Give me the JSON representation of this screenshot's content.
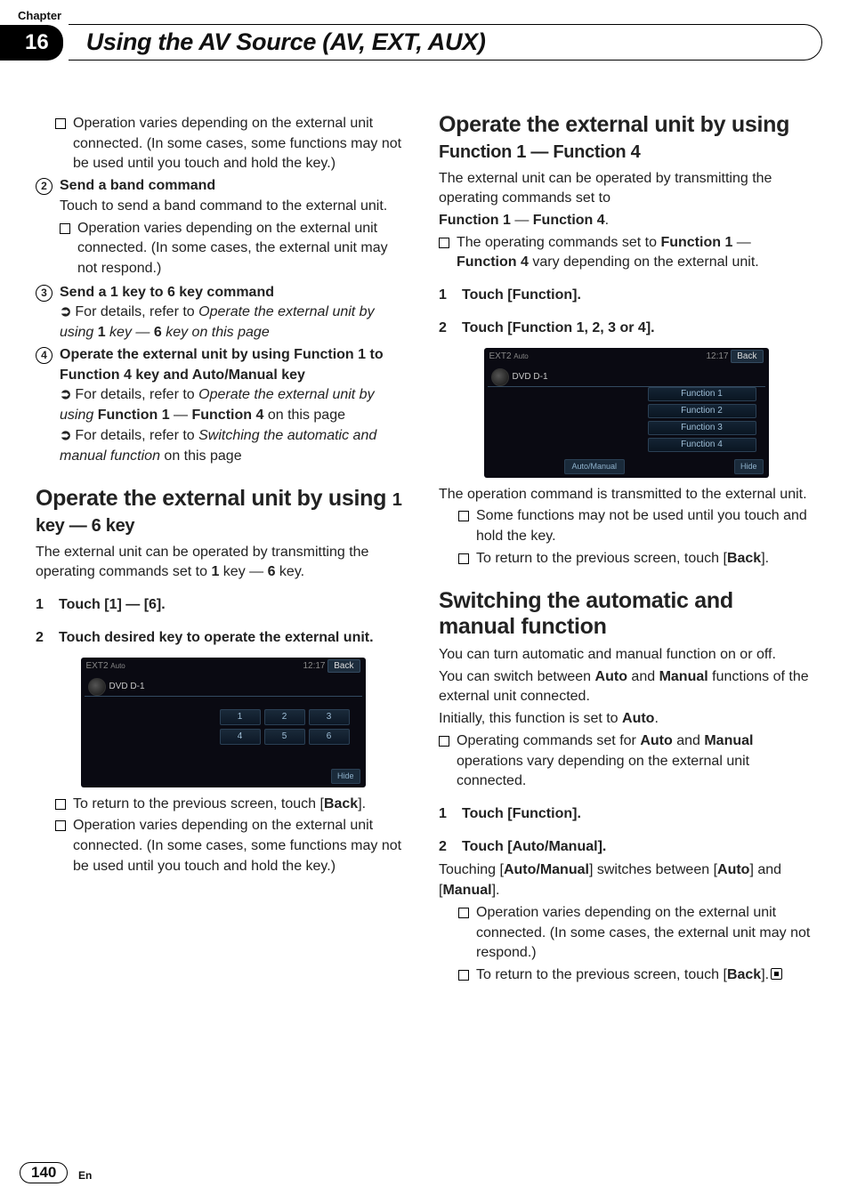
{
  "chapter_label": "Chapter",
  "chapter_number": "16",
  "chapter_title": "Using the AV Source (AV, EXT, AUX)",
  "page_number": "140",
  "lang": "En",
  "left": {
    "intro_bullet": "Operation varies depending on the external unit connected. (In some cases, some functions may not be used until you touch and hold the key.)",
    "item2_title": "Send a band command",
    "item2_body": "Touch to send a band command to the external unit.",
    "item2_bullet": "Operation varies depending on the external unit connected. (In some cases, the external unit may not respond.)",
    "item3_title": "Send a 1 key to 6 key command",
    "item3_ref_prefix": "For details, refer to ",
    "item3_ref_italic": "Operate the external unit by using ",
    "item3_ref_bold1": "1",
    "item3_ref_mid_italic": " key — ",
    "item3_ref_bold2": "6",
    "item3_ref_tail": " key on this page",
    "item4_title": "Operate the external unit by using Function 1 to Function 4 key and Auto/Manual key",
    "item4_ref1_prefix": "For details, refer to ",
    "item4_ref1_italic": "Operate the external unit by using ",
    "item4_ref1_bold1": "Function 1",
    "item4_ref1_mid": " — ",
    "item4_ref1_bold2": "Function 4",
    "item4_ref1_tail": " on this page",
    "item4_ref2_prefix": "For details, refer to ",
    "item4_ref2_italic": "Switching the automatic and manual function",
    "item4_ref2_tail": " on this page",
    "sec1_title_strong": "Operate the external unit by using ",
    "sec1_title_light": "1 key — 6 key",
    "sec1_para_a": "The external unit can be operated by transmitting the operating commands set to ",
    "sec1_para_b1": "1",
    "sec1_para_mid": " key — ",
    "sec1_para_b2": "6",
    "sec1_para_tail": " key.",
    "sec1_step1_num": "1",
    "sec1_step1_text": "Touch [1] — [6].",
    "sec1_step2_num": "2",
    "sec1_step2_text": "Touch desired key to operate the external unit.",
    "sec1_bul1_a": "To return to the previous screen, touch [",
    "sec1_bul1_b": "Back",
    "sec1_bul1_c": "].",
    "sec1_bul2": "Operation varies depending on the external unit connected. (In some cases, some functions may not be used until you touch and hold the key.)"
  },
  "right": {
    "sec2_title_strong": "Operate the external unit by using ",
    "sec2_title_light": "Function 1 — Function 4",
    "sec2_para1": "The external unit can be operated by transmitting the operating commands set to",
    "sec2_para2_b1": "Function 1",
    "sec2_para2_mid": " — ",
    "sec2_para2_b2": "Function 4",
    "sec2_para2_tail": ".",
    "sec2_bullet_a": "The operating commands set to ",
    "sec2_bullet_b1": "Function 1",
    "sec2_bullet_mid": " — ",
    "sec2_bullet_b2": "Function 4",
    "sec2_bullet_tail": " vary depending on the external unit.",
    "sec2_step1_num": "1",
    "sec2_step1_text": "Touch [Function].",
    "sec2_step2_num": "2",
    "sec2_step2_text": "Touch [Function 1, 2, 3 or 4].",
    "sec2_after": "The operation command is transmitted to the external unit.",
    "sec2_bul1": "Some functions may not be used until you touch and hold the key.",
    "sec2_bul2_a": "To return to the previous screen, touch [",
    "sec2_bul2_b": "Back",
    "sec2_bul2_c": "].",
    "sec3_title": "Switching the automatic and manual function",
    "sec3_p1": "You can turn automatic and manual function on or off.",
    "sec3_p2_a": "You can switch between ",
    "sec3_p2_b1": "Auto",
    "sec3_p2_mid": " and ",
    "sec3_p2_b2": "Manual",
    "sec3_p2_tail": " functions of the external unit connected.",
    "sec3_p3_a": "Initially, this function is set to ",
    "sec3_p3_b": "Auto",
    "sec3_p3_tail": ".",
    "sec3_bul1_a": "Operating commands set for ",
    "sec3_bul1_b1": "Auto",
    "sec3_bul1_mid": " and ",
    "sec3_bul1_b2": "Manual",
    "sec3_bul1_tail": " operations vary depending on the external unit connected.",
    "sec3_step1_num": "1",
    "sec3_step1_text": "Touch [Function].",
    "sec3_step2_num": "2",
    "sec3_step2_text": "Touch [Auto/Manual].",
    "sec3_p4_a": "Touching [",
    "sec3_p4_b1": "Auto/Manual",
    "sec3_p4_mid": "] switches between [",
    "sec3_p4_b2": "Auto",
    "sec3_p4_mid2": "] and [",
    "sec3_p4_b3": "Manual",
    "sec3_p4_tail": "].",
    "sec3_bul2": "Operation varies depending on the external unit connected. (In some cases, the external unit may not respond.)",
    "sec3_bul3_a": "To return to the previous screen, touch [",
    "sec3_bul3_b": "Back",
    "sec3_bul3_c": "]."
  },
  "shot1": {
    "title": "EXT2",
    "sub": "Auto",
    "clock": "12:17",
    "back": "Back",
    "track": "DVD D-1",
    "btns": [
      "1",
      "2",
      "3",
      "4",
      "5",
      "6"
    ],
    "hide": "Hide"
  },
  "shot2": {
    "title": "EXT2",
    "sub": "Auto",
    "clock": "12:17",
    "back": "Back",
    "track": "DVD D-1",
    "fns": [
      "Function 1",
      "Function 2",
      "Function 3",
      "Function 4"
    ],
    "auto": "Auto/Manual",
    "hide": "Hide"
  }
}
